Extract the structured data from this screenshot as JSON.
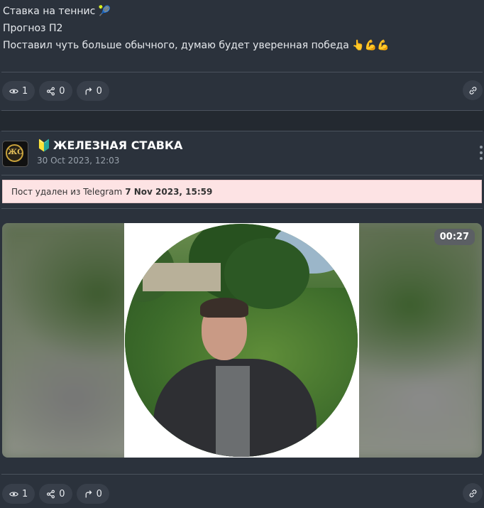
{
  "previous_post": {
    "lines": [
      "Ставка на теннис 🎾",
      "Прогноз П2",
      "Поставил чуть больше обычного, думаю будет уверенная победа 👆💪💪"
    ],
    "stats": {
      "views": "1",
      "shares": "0",
      "forwards": "0"
    }
  },
  "post": {
    "channel": {
      "name": "ЖЕЛЕЗНАЯ СТАВКА",
      "emoji": "🔰",
      "avatar_text": "ЖС"
    },
    "date": "30 Oct 2023, 12:03",
    "deleted_notice": {
      "text": "Пост удален из Telegram",
      "date": "7 Nov 2023, 15:59"
    },
    "video": {
      "duration": "00:27"
    },
    "stats": {
      "views": "1",
      "shares": "0",
      "forwards": "0"
    }
  },
  "icons": {
    "views": "eye-icon",
    "shares": "share-icon",
    "forwards": "forward-icon",
    "link": "link-icon",
    "menu": "more-vertical-icon"
  },
  "colors": {
    "background": "#2b323c",
    "pill": "#383f4a",
    "deleted_bg": "#fde3e4"
  }
}
